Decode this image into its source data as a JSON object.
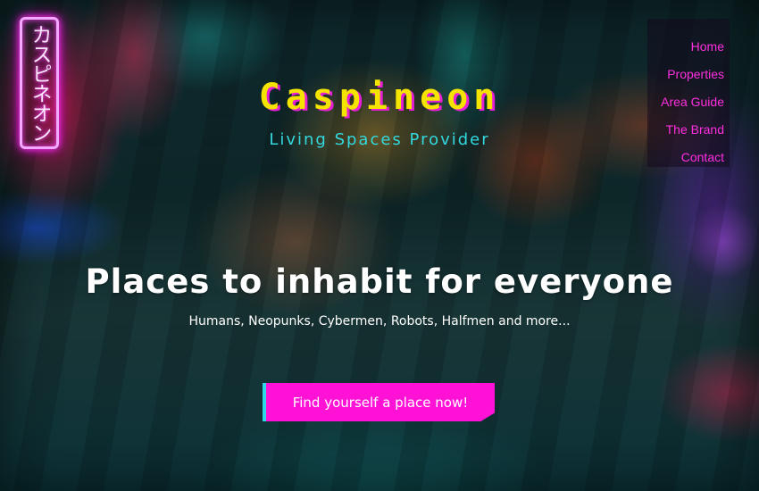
{
  "sign": {
    "text": "カスピネオン"
  },
  "nav": {
    "items": [
      {
        "label": "Home"
      },
      {
        "label": "Properties"
      },
      {
        "label": "Area Guide"
      },
      {
        "label": "The Brand"
      },
      {
        "label": "Contact"
      }
    ]
  },
  "brand": {
    "title": "Caspineon",
    "tagline": "Living Spaces Provider"
  },
  "hero": {
    "headline": "Places to inhabit for everyone",
    "subheadline": "Humans, Neopunks, Cybermen, Robots, Halfmen and more...",
    "cta_label": "Find yourself a place now!"
  },
  "colors": {
    "accent_magenta": "#ff12d6",
    "accent_yellow": "#f4e400",
    "accent_cyan": "#33d8de",
    "nav_link": "#ff2fe0"
  }
}
